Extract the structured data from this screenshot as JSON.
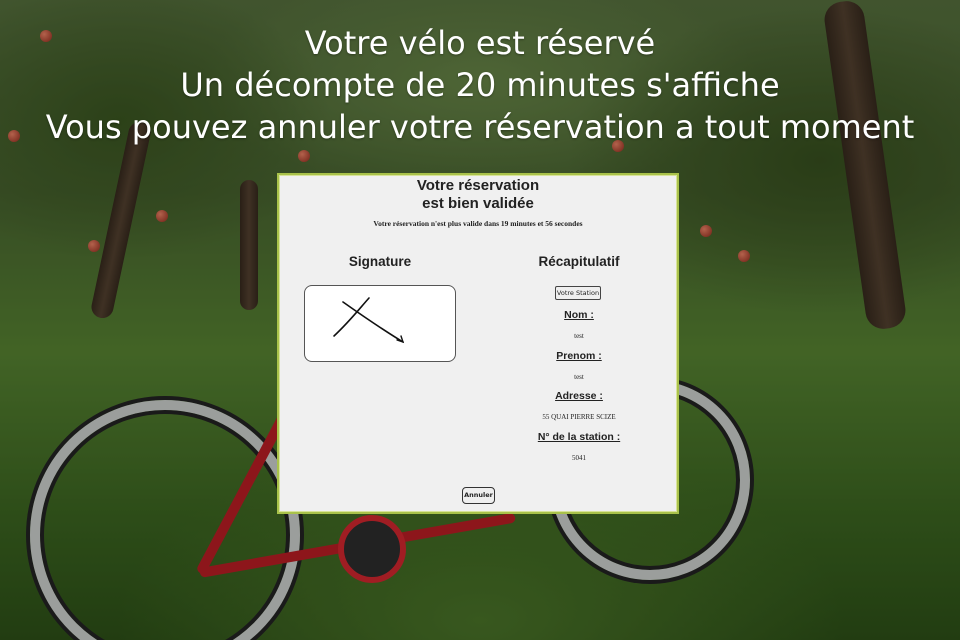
{
  "headline": {
    "line1": "Votre vélo est réservé",
    "line2": "Un décompte de 20 minutes s'affiche",
    "line3": "Vous pouvez annuler votre réservation a tout moment"
  },
  "panel": {
    "title_line1": "Votre réservation",
    "title_line2": "est bien validée",
    "countdown_text": "Votre réservation n'est plus valide dans 19 minutes et 56 secondes",
    "signature_heading": "Signature",
    "recap_heading": "Récapitulatif",
    "station_button_label": "Votre Station",
    "fields": {
      "nom_label": "Nom :",
      "nom_value": "test",
      "prenom_label": "Prenom :",
      "prenom_value": "test",
      "adresse_label": "Adresse :",
      "adresse_value": "55 QUAI PIERRE SCIZE",
      "station_label": "N° de la station :",
      "station_value": "5041"
    },
    "cancel_button_label": "Annuler"
  },
  "colors": {
    "panel_border": "#a9c24a",
    "panel_background": "#f0f0f0",
    "headline_text": "#ffffff"
  },
  "icons": {
    "signature_drawing": "signature-x-mark"
  }
}
